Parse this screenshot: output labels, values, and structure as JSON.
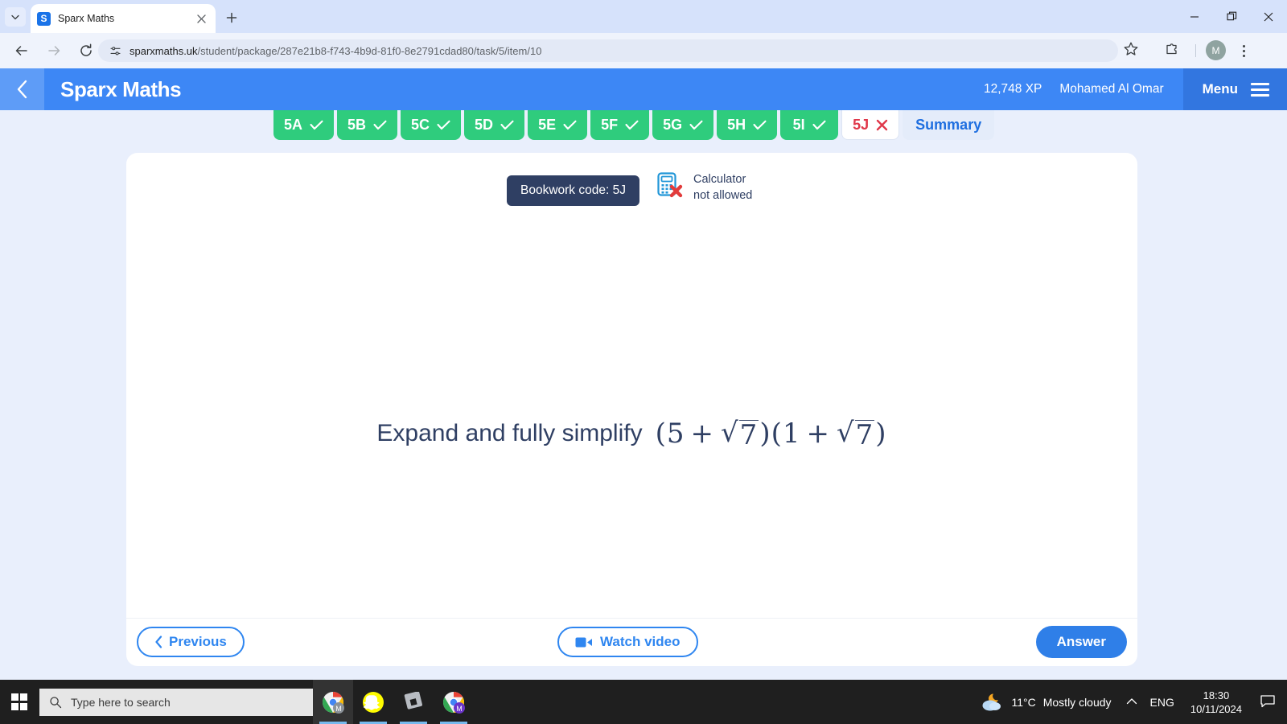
{
  "browser": {
    "tab": {
      "title": "Sparx Maths",
      "favicon_letter": "S",
      "favicon_name": "sparx-favicon"
    },
    "url_host": "sparxmaths.uk",
    "url_path": "/student/package/287e21b8-f743-4b9d-81f0-8e2791cdad80/task/5/item/10",
    "profile_letter": "M"
  },
  "app": {
    "brand": "Sparx Maths",
    "xp": "12,748 XP",
    "username": "Mohamed Al Omar",
    "menu_label": "Menu"
  },
  "tabs": [
    {
      "label": "5A",
      "state": "done"
    },
    {
      "label": "5B",
      "state": "done"
    },
    {
      "label": "5C",
      "state": "done"
    },
    {
      "label": "5D",
      "state": "done"
    },
    {
      "label": "5E",
      "state": "done"
    },
    {
      "label": "5F",
      "state": "done"
    },
    {
      "label": "5G",
      "state": "done"
    },
    {
      "label": "5H",
      "state": "done"
    },
    {
      "label": "5I",
      "state": "done"
    },
    {
      "label": "5J",
      "state": "current"
    },
    {
      "label": "Summary",
      "state": "summary"
    }
  ],
  "question": {
    "bookwork_code": "Bookwork code: 5J",
    "calculator_line1": "Calculator",
    "calculator_line2": "not allowed",
    "prompt": "Expand and fully simplify",
    "math": {
      "open1": "(",
      "term1": "5",
      "plus1": "+",
      "radical1": "√",
      "radicand1": "7",
      "close1": ")",
      "open2": "(",
      "term2": "1",
      "plus2": "+",
      "radical2": "√",
      "radicand2": "7",
      "close2": ")"
    }
  },
  "footer": {
    "previous": "Previous",
    "watch_video": "Watch video",
    "answer": "Answer"
  },
  "taskbar": {
    "search_placeholder": "Type here to search",
    "temperature": "11°C",
    "weather": "Mostly cloudy",
    "language": "ENG",
    "time": "18:30",
    "date": "10/11/2024"
  },
  "colors": {
    "header_blue": "#3d87f5",
    "tab_green": "#2fcc7d",
    "accent_blue": "#2f7fe8",
    "bookwork_navy": "#2f3f63",
    "error_red": "#e0384a"
  }
}
